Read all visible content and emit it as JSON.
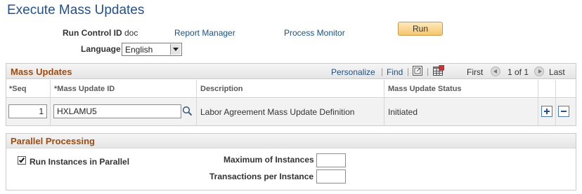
{
  "page": {
    "title": "Execute Mass Updates"
  },
  "run_control": {
    "label": "Run Control ID",
    "value": "doc",
    "report_manager": "Report Manager",
    "process_monitor": "Process Monitor",
    "run_button": "Run"
  },
  "language": {
    "label": "Language",
    "selected": "English"
  },
  "mass_updates": {
    "title": "Mass Updates",
    "toolbar": {
      "personalize": "Personalize",
      "separator": "|",
      "find": "Find",
      "first": "First",
      "range": "1 of 1",
      "last": "Last"
    },
    "columns": {
      "seq": "*Seq",
      "mass_update_id": "*Mass Update ID",
      "description": "Description",
      "status": "Mass Update Status"
    },
    "rows": [
      {
        "seq": "1",
        "mass_update_id": "HXLAMU5",
        "description": "Labor Agreement Mass Update Definition",
        "status": "Initiated"
      }
    ]
  },
  "parallel": {
    "title": "Parallel Processing",
    "run_parallel_label": "Run Instances in Parallel",
    "run_parallel_checked": true,
    "max_instances_label": "Maximum of Instances",
    "max_instances_value": "",
    "transactions_label": "Transactions per Instance",
    "transactions_value": ""
  },
  "colors": {
    "title": "#24518c",
    "link": "#16528c",
    "section_title": "#9c4c11",
    "button_fill": "#f6c66c"
  },
  "icons": [
    "search-icon",
    "view-all-icon",
    "grid-download-icon",
    "previous-icon",
    "next-icon",
    "add-row-icon",
    "delete-row-icon",
    "dropdown-arrow-icon",
    "checkmark-icon"
  ]
}
